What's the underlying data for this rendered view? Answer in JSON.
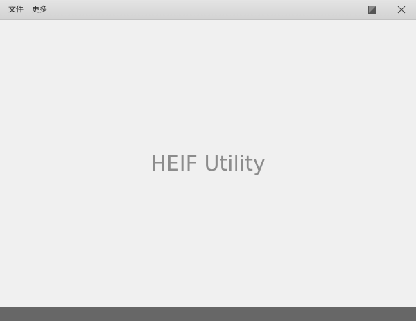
{
  "menu": {
    "items": [
      {
        "label": "文件"
      },
      {
        "label": "更多"
      }
    ]
  },
  "window_controls": {
    "minimize_icon": "minimize-icon",
    "restore_icon": "restore-icon",
    "close_icon": "close-icon"
  },
  "main": {
    "title": "HEIF Utility"
  },
  "colors": {
    "title_text": "#8c8c8c",
    "background": "#f0f0f0",
    "status_bar": "#676767"
  }
}
